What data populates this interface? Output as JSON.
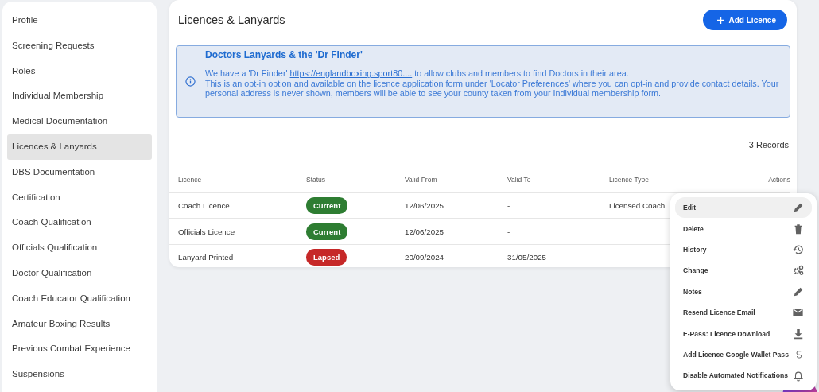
{
  "sidebar": {
    "items": [
      {
        "label": "Profile",
        "selected": false
      },
      {
        "label": "Screening Requests",
        "selected": false
      },
      {
        "label": "Roles",
        "selected": false
      },
      {
        "label": "Individual Membership",
        "selected": false
      },
      {
        "label": "Medical Documentation",
        "selected": false
      },
      {
        "label": "Licences & Lanyards",
        "selected": true
      },
      {
        "label": "DBS Documentation",
        "selected": false
      },
      {
        "label": "Certification",
        "selected": false
      },
      {
        "label": "Coach Qualification",
        "selected": false
      },
      {
        "label": "Officials Qualification",
        "selected": false
      },
      {
        "label": "Doctor Qualification",
        "selected": false
      },
      {
        "label": "Coach Educator Qualification",
        "selected": false
      },
      {
        "label": "Amateur Boxing Results",
        "selected": false
      },
      {
        "label": "Previous Combat Experience",
        "selected": false
      },
      {
        "label": "Suspensions",
        "selected": false
      }
    ]
  },
  "page": {
    "title": "Licences & Lanyards",
    "add_button": "Add Licence"
  },
  "notice": {
    "title": "Doctors Lanyards & the 'Dr Finder'",
    "text_before_link": "We have a 'Dr Finder'",
    "link": "https://englandboxing.sport80....",
    "text_after_link": "to allow clubs and members to find Doctors in their area.",
    "text_2": "This is an opt-in option and available on the licence application form under 'Locator Preferences' where you can opt-in and provide contact details. Your personal address is never shown, members will be able to see your county taken from your Individual membership form."
  },
  "records_count": "3 Records",
  "table": {
    "columns": [
      "Licence",
      "Status",
      "Valid From",
      "Valid To",
      "Licence Type",
      "Actions"
    ],
    "rows": [
      {
        "licence": "Coach Licence",
        "status": "Current",
        "color": "#2e7d32",
        "valid_from": "12/06/2025",
        "valid_to": "-",
        "licence_type": "Licensed Coach"
      },
      {
        "licence": "Officials Licence",
        "status": "Current",
        "color": "#2e7d32",
        "valid_from": "12/06/2025",
        "valid_to": "-"
      },
      {
        "licence": "Lanyard Printed",
        "status": "Lapsed",
        "color": "#c62828",
        "valid_from": "20/09/2024",
        "valid_to": "31/05/2025"
      }
    ]
  },
  "actions_menu": {
    "items": [
      {
        "label": "Edit",
        "selected": true
      },
      {
        "label": "Delete",
        "selected": false
      },
      {
        "label": "History",
        "selected": false
      },
      {
        "label": "Change",
        "selected": false
      },
      {
        "label": "Notes",
        "selected": false
      },
      {
        "label": "Resend Licence Email",
        "selected": false
      },
      {
        "label": "E-Pass: Licence Download",
        "selected": false
      },
      {
        "label": "Add Licence Google Wallet Pass",
        "selected": false
      },
      {
        "label": "Disable Automated Notifications",
        "selected": false
      }
    ]
  }
}
